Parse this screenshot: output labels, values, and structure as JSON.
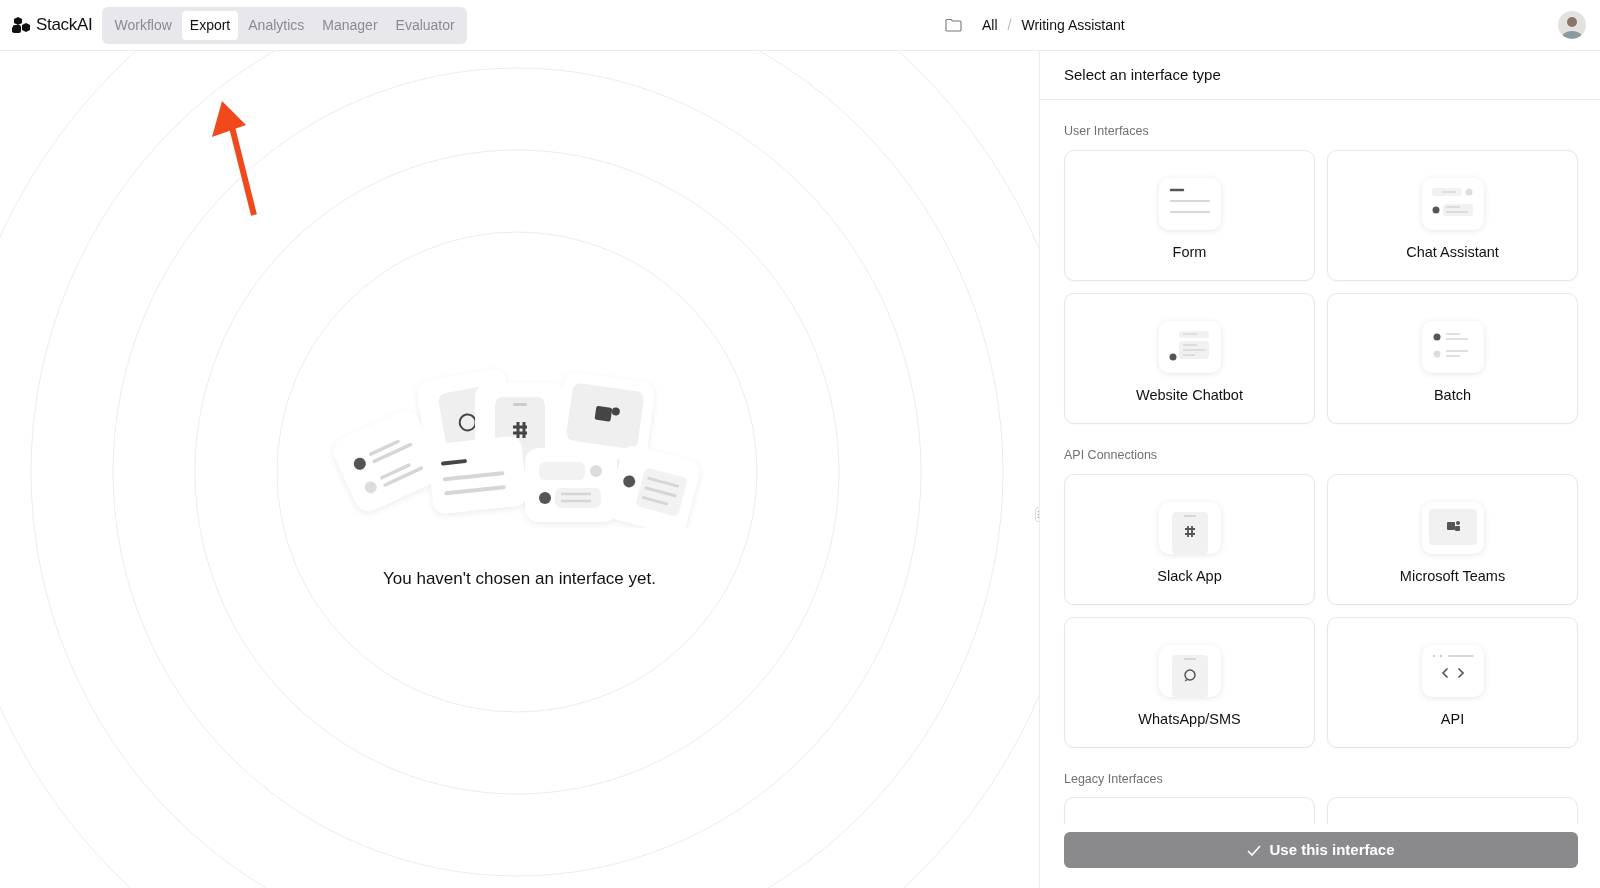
{
  "brand": {
    "name": "StackAI"
  },
  "tabs": [
    {
      "label": "Workflow",
      "selected": false
    },
    {
      "label": "Export",
      "selected": true
    },
    {
      "label": "Analytics",
      "selected": false
    },
    {
      "label": "Manager",
      "selected": false
    },
    {
      "label": "Evaluator",
      "selected": false
    }
  ],
  "breadcrumb": {
    "items": [
      "All",
      "Writing Assistant"
    ],
    "separator": "/"
  },
  "empty_state": {
    "message": "You haven't chosen an interface yet."
  },
  "panel": {
    "title": "Select an interface type",
    "sections": [
      {
        "label": "User Interfaces",
        "cards": [
          {
            "label": "Form",
            "kind": "form",
            "selected": false
          },
          {
            "label": "Chat Assistant",
            "kind": "chat",
            "selected": false
          },
          {
            "label": "Website Chatbot",
            "kind": "website",
            "selected": false
          },
          {
            "label": "Batch",
            "kind": "batch",
            "selected": false
          }
        ]
      },
      {
        "label": "API Connections",
        "cards": [
          {
            "label": "Slack App",
            "kind": "slack",
            "selected": false
          },
          {
            "label": "Microsoft Teams",
            "kind": "teams",
            "selected": false
          },
          {
            "label": "WhatsApp/SMS",
            "kind": "whatsapp",
            "selected": false
          },
          {
            "label": "API",
            "kind": "api",
            "selected": false
          }
        ]
      },
      {
        "label": "Legacy Interfaces",
        "cards": [
          {
            "kind": "blank",
            "selected": false
          },
          {
            "kind": "blank",
            "selected": false
          }
        ]
      }
    ],
    "button": {
      "label": "Use this interface",
      "disabled": true
    }
  }
}
